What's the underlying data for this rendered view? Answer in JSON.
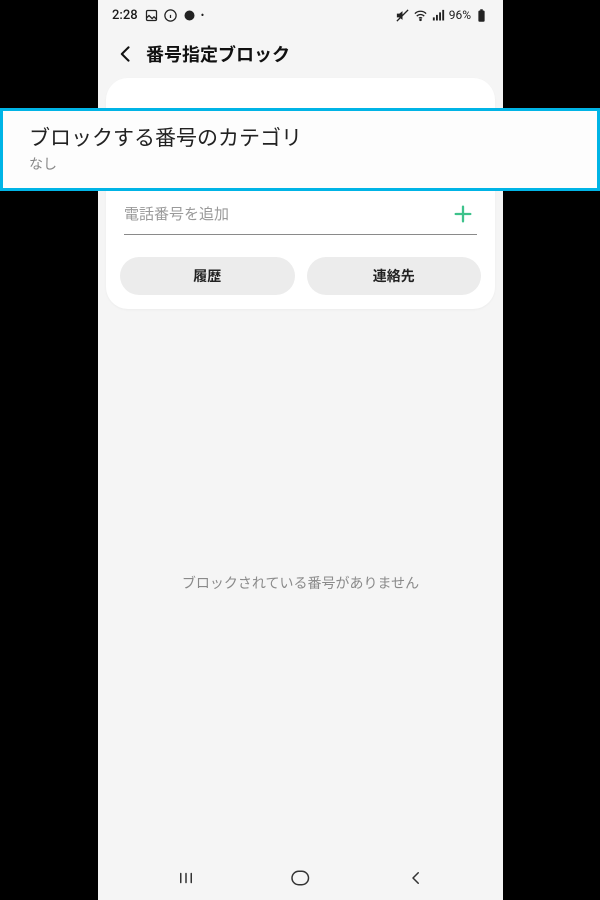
{
  "status": {
    "time": "2:28",
    "battery_pct": "96%"
  },
  "header": {
    "title": "番号指定ブロック"
  },
  "category": {
    "title": "ブロックする番号のカテゴリ",
    "subtitle": "なし"
  },
  "input": {
    "placeholder": "電話番号を追加"
  },
  "buttons": {
    "history": "履歴",
    "contacts": "連絡先"
  },
  "empty": {
    "message": "ブロックされている番号がありません"
  }
}
